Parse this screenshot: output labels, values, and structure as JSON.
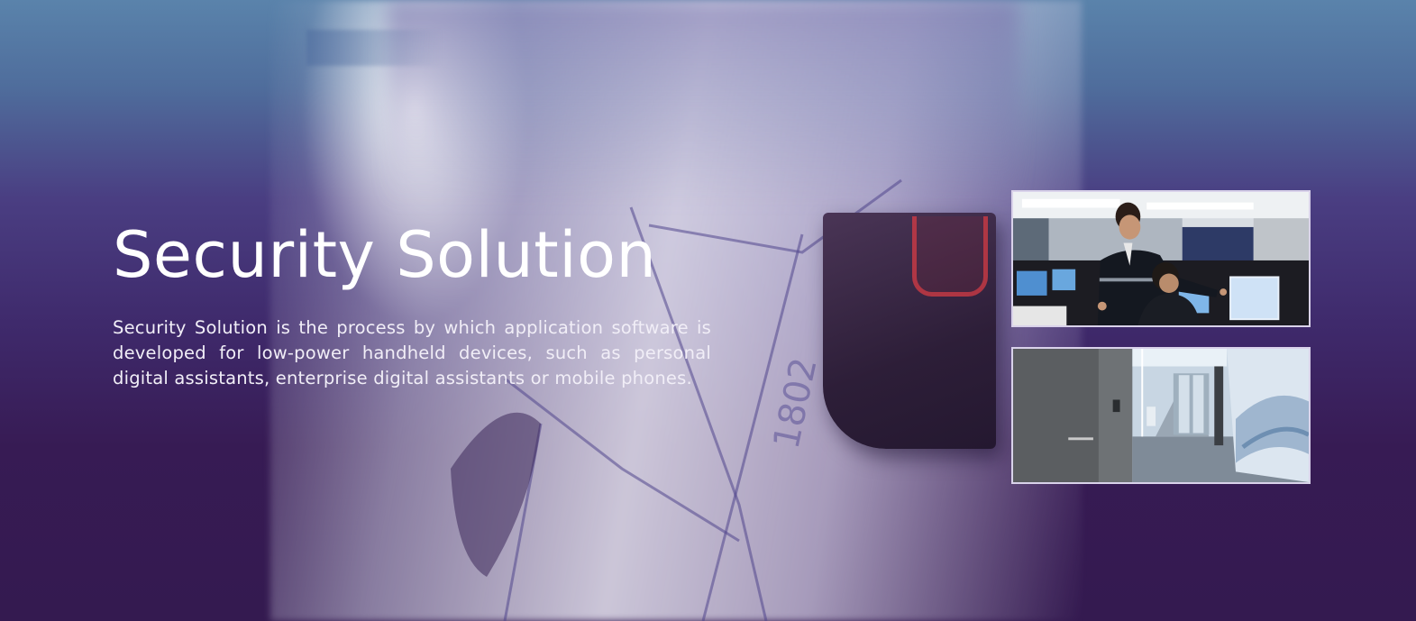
{
  "hero": {
    "title": "Security Solution",
    "description": "Security Solution is the process by which application software is developed for low-power handheld devices, such as personal digital assistants, enterprise digital assistants or mobile phones."
  },
  "images": {
    "primary": "security-control-room-photo",
    "secondary": "secure-office-corridor-photo",
    "background": "access-card-reader-photo"
  },
  "colors": {
    "background_top": "#5a83ab",
    "background_bottom": "#341a50",
    "frame": "#d9d2ea",
    "text": "#ffffff"
  }
}
